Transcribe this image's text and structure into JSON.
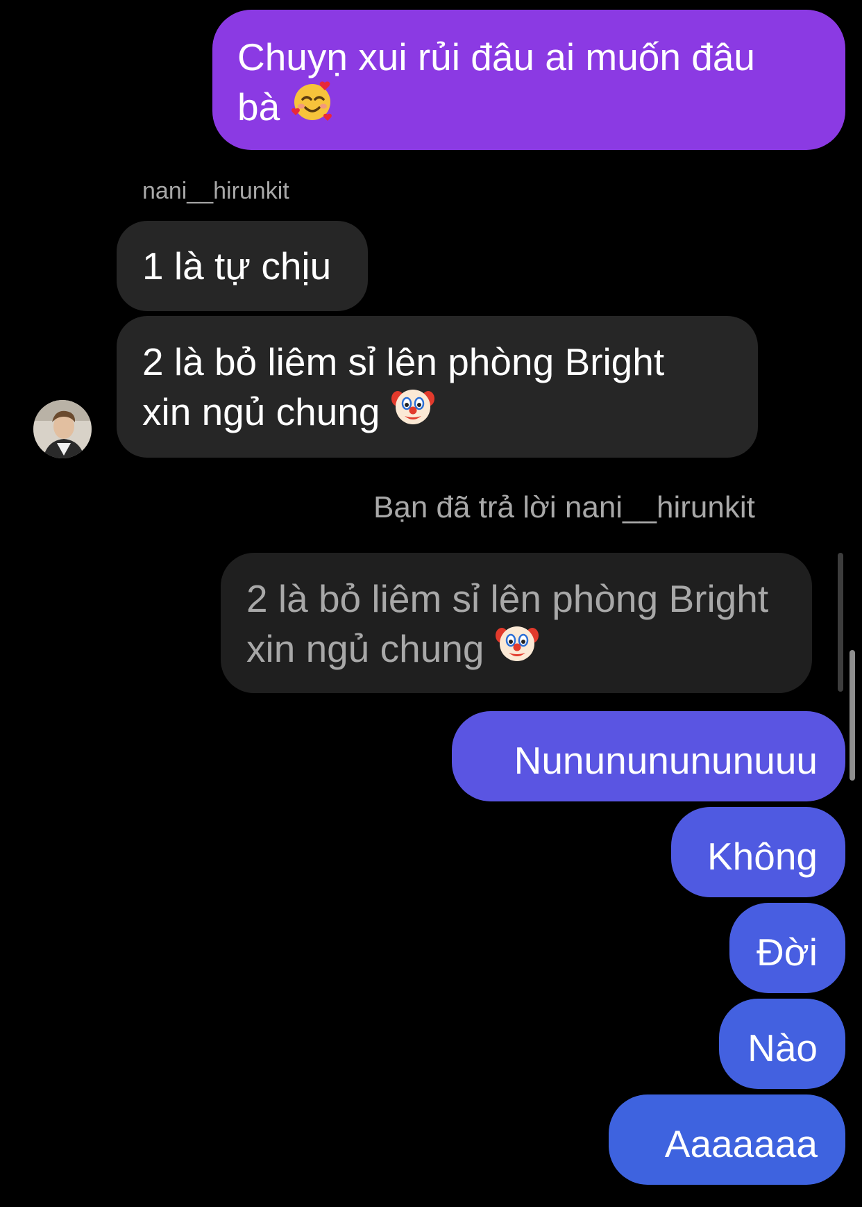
{
  "colors": {
    "background": "#000000",
    "received_bubble": "#262626",
    "quoted_bubble": "#1f1f1f",
    "sent_gradient_top": "#8b3ae3",
    "sent_gradient_bottom": "#3e5fe0",
    "meta_text": "#a8a8a8"
  },
  "messages": {
    "m1": {
      "line1": "Chuyṇ xui rủi đâu ai muốn đâu",
      "line2": "bà",
      "emoji": "smiling-face-with-hearts-icon"
    },
    "sender_name": "nani__hirunkit",
    "m2": {
      "text": "1 là tự chịu"
    },
    "m3": {
      "line1": "2 là bỏ liêm sỉ lên phòng Bright",
      "line2": "xin ngủ chung",
      "emoji": "clown-face-icon"
    },
    "reply_label": "Bạn đã trả lời nani__hirunkit",
    "quoted": {
      "line1": "2 là bỏ liêm sỉ lên phòng Bright",
      "line2": "xin ngủ chung",
      "emoji": "clown-face-icon"
    },
    "m4": {
      "text": "Nunununununuuu"
    },
    "m5": {
      "text": "Không"
    },
    "m6": {
      "text": "Đời"
    },
    "m7": {
      "text": "Nào"
    },
    "m8": {
      "text": "Aaaaaaa"
    }
  }
}
